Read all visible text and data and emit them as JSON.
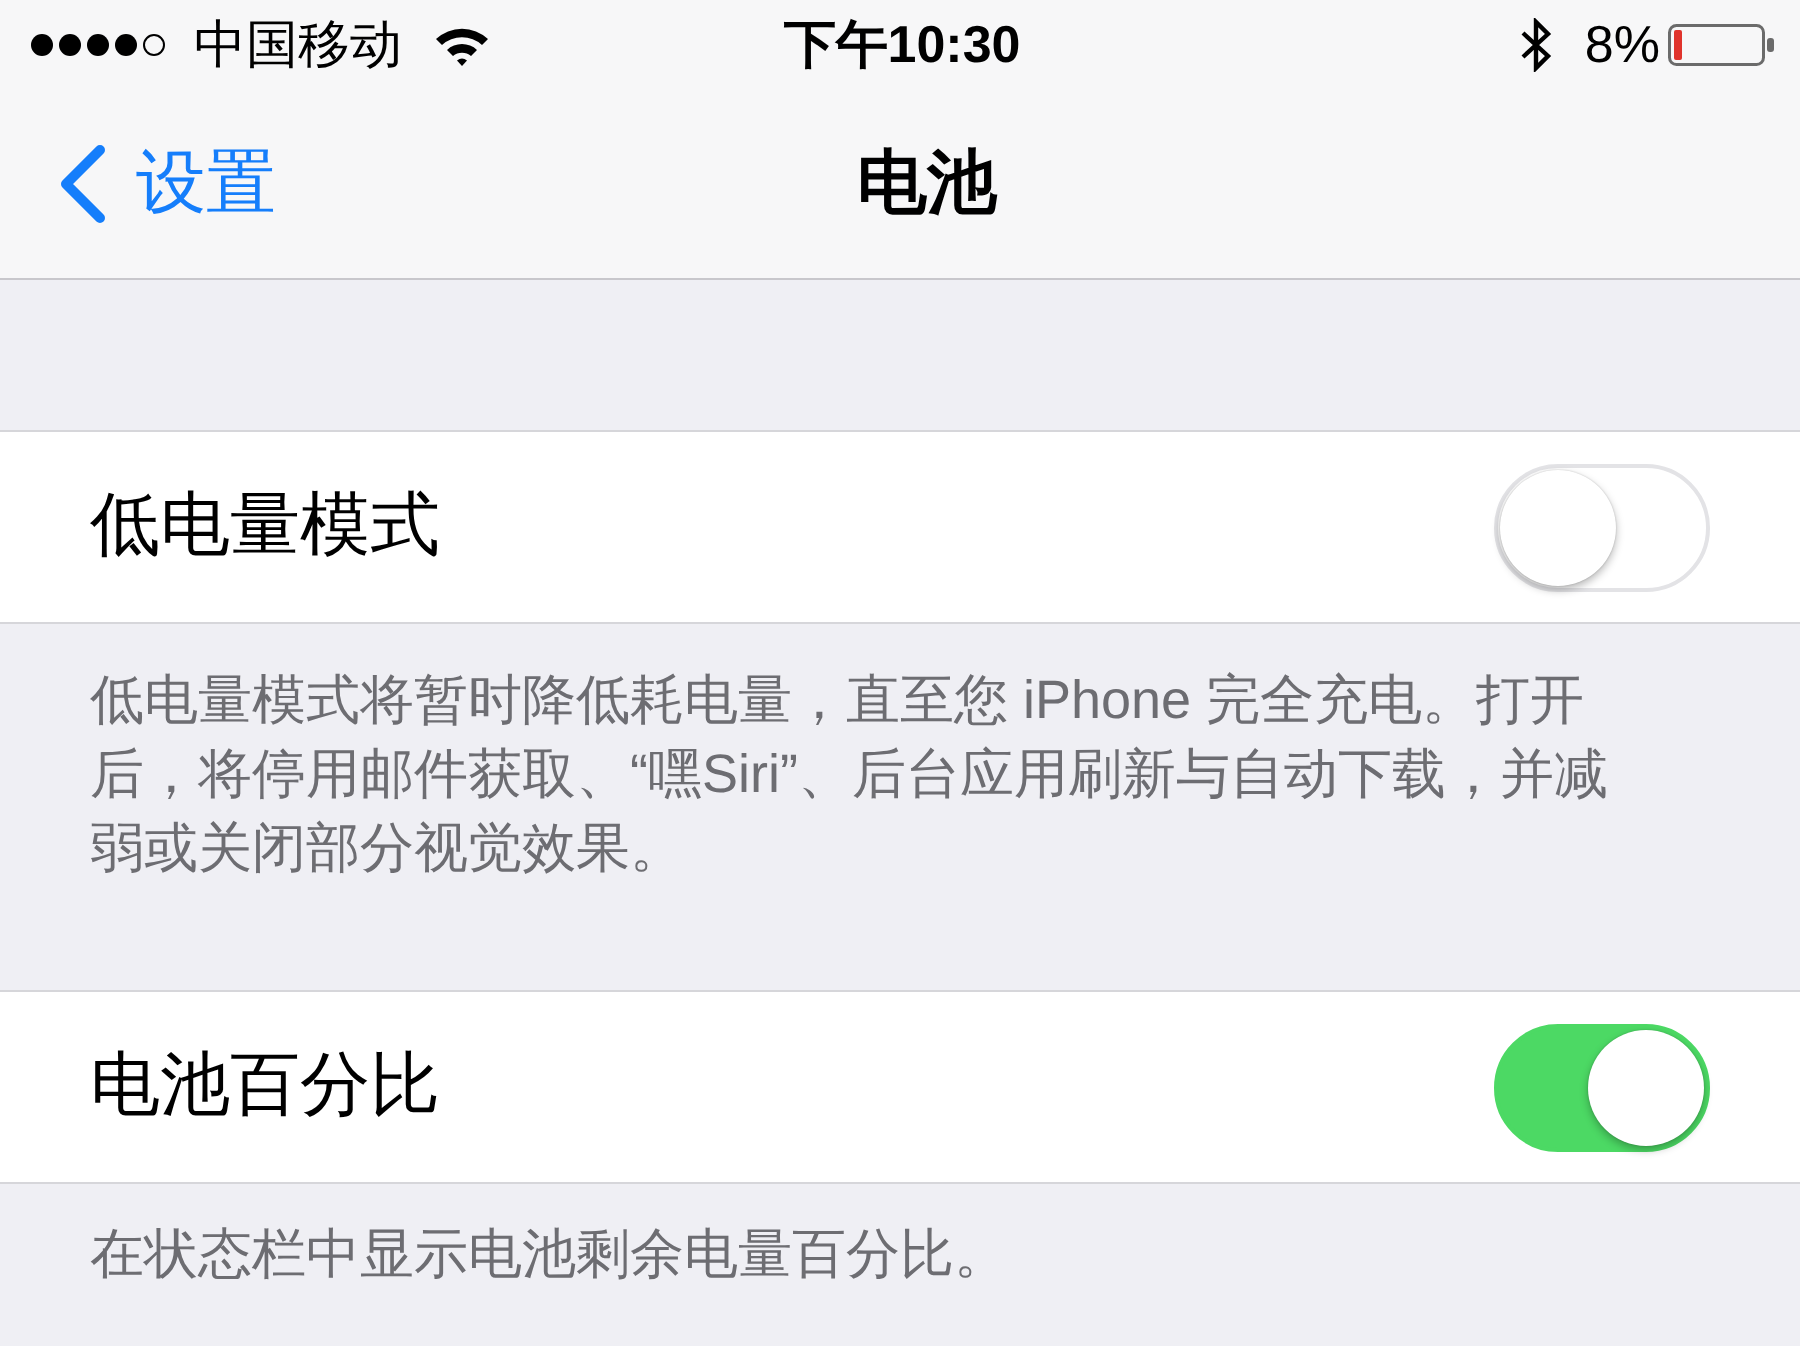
{
  "status_bar": {
    "carrier": "中国移动",
    "time": "下午10:30",
    "battery_percent": "8%"
  },
  "navigation": {
    "back_label": "设置",
    "title": "电池"
  },
  "settings": [
    {
      "label": "低电量模式",
      "on": false,
      "footer": "低电量模式将暂时降低耗电量，直至您 iPhone 完全充电。打开后，将停用邮件获取、“嘿Siri”、后台应用刷新与自动下载，并减弱或关闭部分视觉效果。"
    },
    {
      "label": "电池百分比",
      "on": true,
      "footer": "在状态栏中显示电池剩余电量百分比。"
    }
  ]
}
